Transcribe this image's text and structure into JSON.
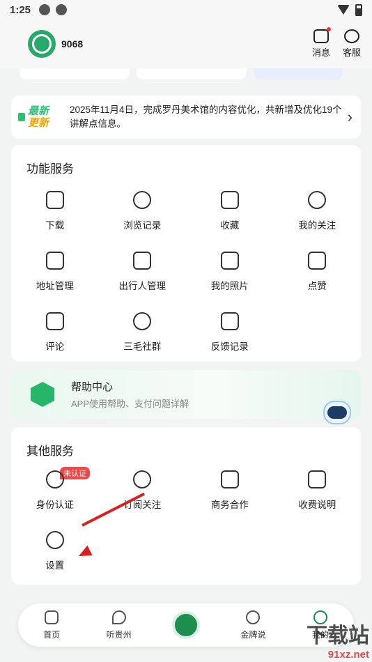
{
  "status_bar": {
    "time": "1:25"
  },
  "header": {
    "username": "9068",
    "messages_label": "消息",
    "service_label": "客服"
  },
  "notice": {
    "tag_line1": "最新",
    "tag_line2": "更新",
    "text": "2025年11月4日，完成罗丹美术馆的内容优化，共新增及优化19个讲解点信息。"
  },
  "function_services": {
    "title": "功能服务",
    "items": [
      {
        "label": "下载",
        "icon": "download-icon"
      },
      {
        "label": "浏览记录",
        "icon": "history-icon"
      },
      {
        "label": "收藏",
        "icon": "star-bookmark-icon"
      },
      {
        "label": "我的关注",
        "icon": "user-follow-icon"
      },
      {
        "label": "地址管理",
        "icon": "send-icon"
      },
      {
        "label": "出行人管理",
        "icon": "id-card-icon"
      },
      {
        "label": "我的照片",
        "icon": "photo-icon"
      },
      {
        "label": "点赞",
        "icon": "thumb-up-icon"
      },
      {
        "label": "评论",
        "icon": "comment-icon"
      },
      {
        "label": "三毛社群",
        "icon": "group-icon"
      },
      {
        "label": "反馈记录",
        "icon": "feedback-icon"
      }
    ]
  },
  "help_center": {
    "title": "帮助中心",
    "subtitle": "APP使用帮助、支付问题详解"
  },
  "other_services": {
    "title": "其他服务",
    "items": [
      {
        "label": "身份认证",
        "icon": "identity-icon",
        "badge": "未认证"
      },
      {
        "label": "订阅关注",
        "icon": "subscribe-heart-icon"
      },
      {
        "label": "商务合作",
        "icon": "handshake-icon"
      },
      {
        "label": "收费说明",
        "icon": "fee-doc-icon"
      },
      {
        "label": "设置",
        "icon": "settings-icon"
      }
    ]
  },
  "tabbar": {
    "tabs": [
      "首页",
      "听贵州",
      "",
      "金牌说",
      "我的"
    ]
  },
  "watermark": {
    "site": "下载站",
    "url": "91xz.net"
  }
}
